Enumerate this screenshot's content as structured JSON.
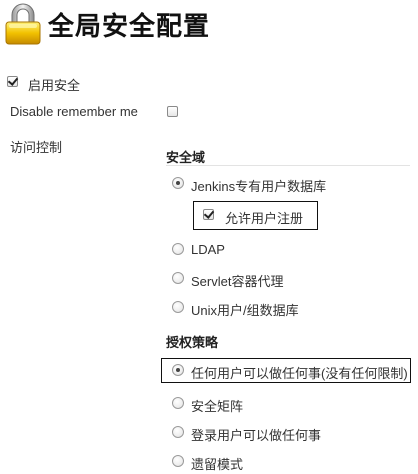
{
  "header": {
    "title": "全局安全配置",
    "icon": "lock-icon"
  },
  "settings": {
    "enable_security": {
      "label": "启用安全",
      "checked": true
    },
    "disable_remember_me": {
      "label": "Disable remember me",
      "checked": false
    },
    "access_control_label": "访问控制"
  },
  "security_realm": {
    "title": "安全域",
    "options": [
      {
        "label": "Jenkins专有用户数据库",
        "selected": true
      },
      {
        "label": "LDAP",
        "selected": false
      },
      {
        "label": "Servlet容器代理",
        "selected": false
      },
      {
        "label": "Unix用户/组数据库",
        "selected": false
      }
    ],
    "allow_signup": {
      "label": "允许用户注册",
      "checked": true
    }
  },
  "authorization": {
    "title": "授权策略",
    "options": [
      {
        "label": "任何用户可以做任何事(没有任何限制)",
        "selected": true
      },
      {
        "label": "安全矩阵",
        "selected": false
      },
      {
        "label": "登录用户可以做任何事",
        "selected": false
      },
      {
        "label": "遗留模式",
        "selected": false
      }
    ]
  }
}
